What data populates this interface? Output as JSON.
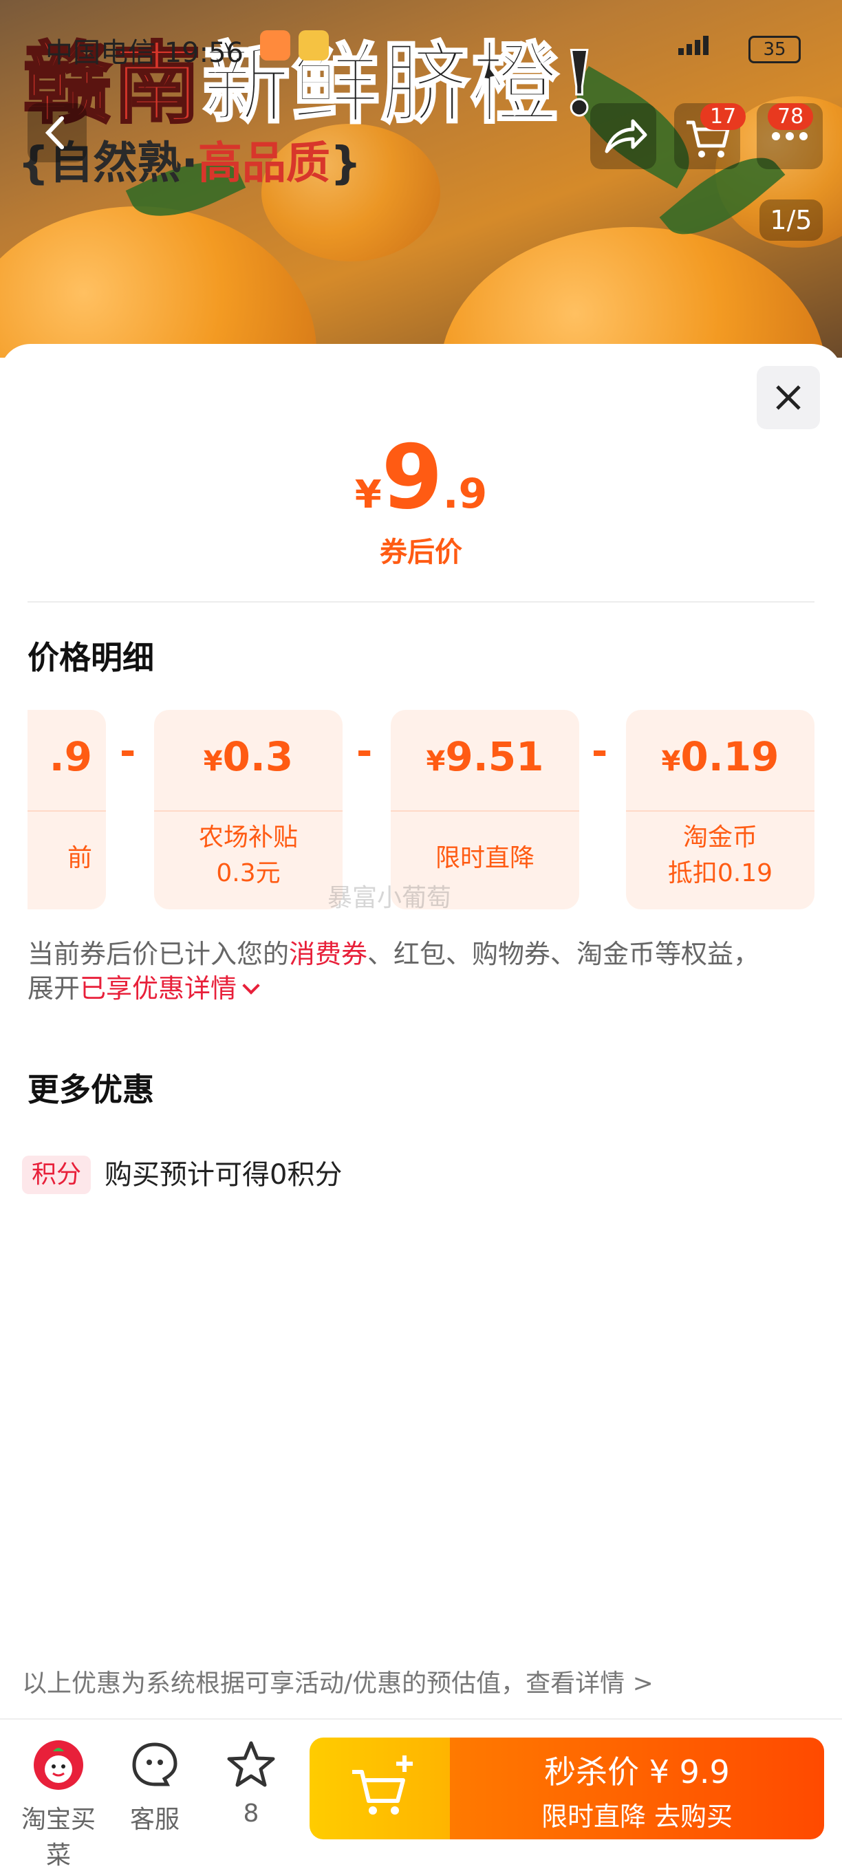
{
  "status_bar": {
    "carrier": "中国电信",
    "time": "19:56",
    "battery": "35"
  },
  "banner": {
    "title_part1": "赣南",
    "title_part2": "新鲜脐橙!",
    "subtitle_open": "{自然熟·",
    "subtitle_highlight": "高品质",
    "subtitle_close": "}",
    "cart_badge": "17",
    "more_badge": "78",
    "image_counter": "1/5"
  },
  "price": {
    "currency": "¥",
    "integer": "9",
    "decimal": ".9",
    "label": "券后价"
  },
  "breakdown": {
    "title": "价格明细",
    "cards": [
      {
        "amount": ".9",
        "label": "前"
      },
      {
        "amount": "0.3",
        "label_line1": "农场补贴",
        "label_line2": "0.3元"
      },
      {
        "amount": "9.51",
        "label": "限时直降"
      },
      {
        "amount": "0.19",
        "label_line1": "淘金币",
        "label_line2": "抵扣0.19"
      }
    ],
    "operator": "-",
    "currency": "¥",
    "watermark": "暴富小葡萄"
  },
  "description": {
    "part1": "当前券后价已计入您的",
    "highlight1": "消费券",
    "part2": "、红包、购物券、淘金币等权益，",
    "part3": "展开",
    "highlight2": "已享优惠详情"
  },
  "more_offers": {
    "title": "更多优惠",
    "tag": "积分",
    "text": "购买预计可得0积分"
  },
  "footnote": "以上优惠为系统根据可享活动/优惠的预估值，查看详情 >",
  "bottom_bar": {
    "shop_label": "淘宝买菜",
    "service_label": "客服",
    "favorite_count": "8",
    "buy_line1": "秒杀价 ¥ 9.9",
    "buy_line2": "限时直降  去购买"
  },
  "colors": {
    "accent": "#ff5b13",
    "red": "#e8203a",
    "card_bg": "#fff1ea"
  }
}
